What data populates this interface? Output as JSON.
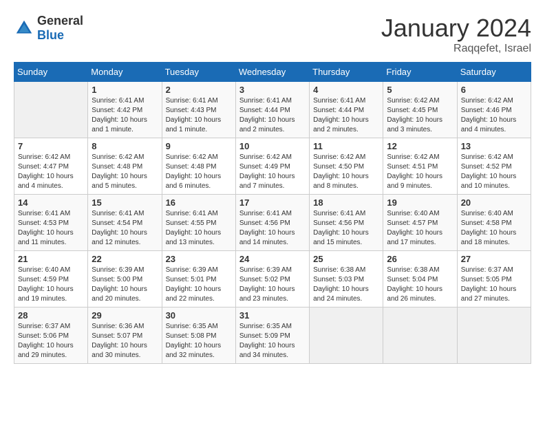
{
  "header": {
    "logo": {
      "text_general": "General",
      "text_blue": "Blue"
    },
    "title": "January 2024",
    "subtitle": "Raqqefet, Israel"
  },
  "calendar": {
    "days_of_week": [
      "Sunday",
      "Monday",
      "Tuesday",
      "Wednesday",
      "Thursday",
      "Friday",
      "Saturday"
    ],
    "weeks": [
      [
        {
          "day": "",
          "empty": true
        },
        {
          "day": "1",
          "sunrise": "Sunrise: 6:41 AM",
          "sunset": "Sunset: 4:42 PM",
          "daylight": "Daylight: 10 hours and 1 minute."
        },
        {
          "day": "2",
          "sunrise": "Sunrise: 6:41 AM",
          "sunset": "Sunset: 4:43 PM",
          "daylight": "Daylight: 10 hours and 1 minute."
        },
        {
          "day": "3",
          "sunrise": "Sunrise: 6:41 AM",
          "sunset": "Sunset: 4:44 PM",
          "daylight": "Daylight: 10 hours and 2 minutes."
        },
        {
          "day": "4",
          "sunrise": "Sunrise: 6:41 AM",
          "sunset": "Sunset: 4:44 PM",
          "daylight": "Daylight: 10 hours and 2 minutes."
        },
        {
          "day": "5",
          "sunrise": "Sunrise: 6:42 AM",
          "sunset": "Sunset: 4:45 PM",
          "daylight": "Daylight: 10 hours and 3 minutes."
        },
        {
          "day": "6",
          "sunrise": "Sunrise: 6:42 AM",
          "sunset": "Sunset: 4:46 PM",
          "daylight": "Daylight: 10 hours and 4 minutes."
        }
      ],
      [
        {
          "day": "7",
          "sunrise": "Sunrise: 6:42 AM",
          "sunset": "Sunset: 4:47 PM",
          "daylight": "Daylight: 10 hours and 4 minutes."
        },
        {
          "day": "8",
          "sunrise": "Sunrise: 6:42 AM",
          "sunset": "Sunset: 4:48 PM",
          "daylight": "Daylight: 10 hours and 5 minutes."
        },
        {
          "day": "9",
          "sunrise": "Sunrise: 6:42 AM",
          "sunset": "Sunset: 4:48 PM",
          "daylight": "Daylight: 10 hours and 6 minutes."
        },
        {
          "day": "10",
          "sunrise": "Sunrise: 6:42 AM",
          "sunset": "Sunset: 4:49 PM",
          "daylight": "Daylight: 10 hours and 7 minutes."
        },
        {
          "day": "11",
          "sunrise": "Sunrise: 6:42 AM",
          "sunset": "Sunset: 4:50 PM",
          "daylight": "Daylight: 10 hours and 8 minutes."
        },
        {
          "day": "12",
          "sunrise": "Sunrise: 6:42 AM",
          "sunset": "Sunset: 4:51 PM",
          "daylight": "Daylight: 10 hours and 9 minutes."
        },
        {
          "day": "13",
          "sunrise": "Sunrise: 6:42 AM",
          "sunset": "Sunset: 4:52 PM",
          "daylight": "Daylight: 10 hours and 10 minutes."
        }
      ],
      [
        {
          "day": "14",
          "sunrise": "Sunrise: 6:41 AM",
          "sunset": "Sunset: 4:53 PM",
          "daylight": "Daylight: 10 hours and 11 minutes."
        },
        {
          "day": "15",
          "sunrise": "Sunrise: 6:41 AM",
          "sunset": "Sunset: 4:54 PM",
          "daylight": "Daylight: 10 hours and 12 minutes."
        },
        {
          "day": "16",
          "sunrise": "Sunrise: 6:41 AM",
          "sunset": "Sunset: 4:55 PM",
          "daylight": "Daylight: 10 hours and 13 minutes."
        },
        {
          "day": "17",
          "sunrise": "Sunrise: 6:41 AM",
          "sunset": "Sunset: 4:56 PM",
          "daylight": "Daylight: 10 hours and 14 minutes."
        },
        {
          "day": "18",
          "sunrise": "Sunrise: 6:41 AM",
          "sunset": "Sunset: 4:56 PM",
          "daylight": "Daylight: 10 hours and 15 minutes."
        },
        {
          "day": "19",
          "sunrise": "Sunrise: 6:40 AM",
          "sunset": "Sunset: 4:57 PM",
          "daylight": "Daylight: 10 hours and 17 minutes."
        },
        {
          "day": "20",
          "sunrise": "Sunrise: 6:40 AM",
          "sunset": "Sunset: 4:58 PM",
          "daylight": "Daylight: 10 hours and 18 minutes."
        }
      ],
      [
        {
          "day": "21",
          "sunrise": "Sunrise: 6:40 AM",
          "sunset": "Sunset: 4:59 PM",
          "daylight": "Daylight: 10 hours and 19 minutes."
        },
        {
          "day": "22",
          "sunrise": "Sunrise: 6:39 AM",
          "sunset": "Sunset: 5:00 PM",
          "daylight": "Daylight: 10 hours and 20 minutes."
        },
        {
          "day": "23",
          "sunrise": "Sunrise: 6:39 AM",
          "sunset": "Sunset: 5:01 PM",
          "daylight": "Daylight: 10 hours and 22 minutes."
        },
        {
          "day": "24",
          "sunrise": "Sunrise: 6:39 AM",
          "sunset": "Sunset: 5:02 PM",
          "daylight": "Daylight: 10 hours and 23 minutes."
        },
        {
          "day": "25",
          "sunrise": "Sunrise: 6:38 AM",
          "sunset": "Sunset: 5:03 PM",
          "daylight": "Daylight: 10 hours and 24 minutes."
        },
        {
          "day": "26",
          "sunrise": "Sunrise: 6:38 AM",
          "sunset": "Sunset: 5:04 PM",
          "daylight": "Daylight: 10 hours and 26 minutes."
        },
        {
          "day": "27",
          "sunrise": "Sunrise: 6:37 AM",
          "sunset": "Sunset: 5:05 PM",
          "daylight": "Daylight: 10 hours and 27 minutes."
        }
      ],
      [
        {
          "day": "28",
          "sunrise": "Sunrise: 6:37 AM",
          "sunset": "Sunset: 5:06 PM",
          "daylight": "Daylight: 10 hours and 29 minutes."
        },
        {
          "day": "29",
          "sunrise": "Sunrise: 6:36 AM",
          "sunset": "Sunset: 5:07 PM",
          "daylight": "Daylight: 10 hours and 30 minutes."
        },
        {
          "day": "30",
          "sunrise": "Sunrise: 6:35 AM",
          "sunset": "Sunset: 5:08 PM",
          "daylight": "Daylight: 10 hours and 32 minutes."
        },
        {
          "day": "31",
          "sunrise": "Sunrise: 6:35 AM",
          "sunset": "Sunset: 5:09 PM",
          "daylight": "Daylight: 10 hours and 34 minutes."
        },
        {
          "day": "",
          "empty": true
        },
        {
          "day": "",
          "empty": true
        },
        {
          "day": "",
          "empty": true
        }
      ]
    ]
  }
}
